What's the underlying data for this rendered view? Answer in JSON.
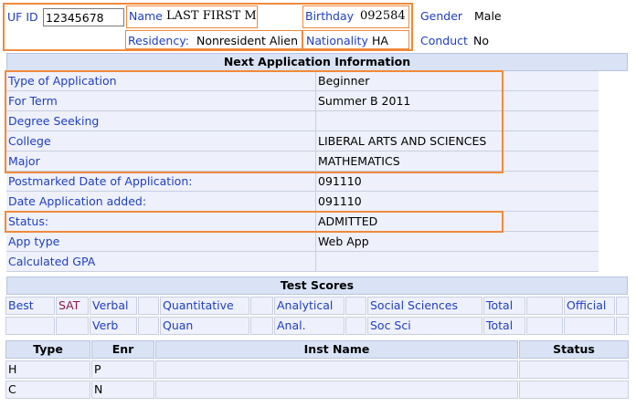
{
  "header": {
    "ufid_label": "UF ID",
    "ufid_value": "12345678",
    "name_label": "Name",
    "name_value": "LAST  FIRST M",
    "birthday_label": "Birthday",
    "birthday_value": "092584",
    "gender_label": "Gender",
    "gender_value": "Male",
    "residency_label": "Residency:",
    "residency_value": "Nonresident Alien",
    "nationality_label": "Nationality",
    "nationality_value": "HA",
    "conduct_label": "Conduct",
    "conduct_value": "No"
  },
  "application": {
    "title": "Next Application Information",
    "rows": [
      {
        "label": "Type of Application",
        "value": "Beginner"
      },
      {
        "label": "For Term",
        "value": "Summer B 2011"
      },
      {
        "label": "Degree Seeking",
        "value": ""
      },
      {
        "label": "College",
        "value": "LIBERAL ARTS AND SCIENCES"
      },
      {
        "label": "Major",
        "value": "MATHEMATICS"
      },
      {
        "label": "Postmarked Date of Application:",
        "value": "091110"
      },
      {
        "label": "Date Application added:",
        "value": "091110"
      },
      {
        "label": "Status:",
        "value": "ADMITTED"
      },
      {
        "label": "App type",
        "value": "Web App"
      },
      {
        "label": "Calculated GPA",
        "value": ""
      }
    ]
  },
  "test_scores": {
    "title": "Test Scores",
    "row1": [
      "Best",
      "SAT",
      "Verbal",
      "",
      "Quantitative",
      "",
      "Analytical",
      "",
      "Social Sciences",
      "Total",
      "",
      "Official",
      ""
    ],
    "row2": [
      "",
      "",
      "Verb",
      "",
      "Quan",
      "",
      "Anal.",
      "",
      "Soc Sci",
      "Total",
      "",
      "",
      ""
    ]
  },
  "inst_table": {
    "headers": [
      "Type",
      "Enr",
      "Inst Name",
      "Status"
    ],
    "rows": [
      [
        "H",
        "P",
        "",
        ""
      ],
      [
        "C",
        "N",
        "",
        ""
      ]
    ]
  },
  "colors": {
    "label": "#1f3fbf",
    "highlight": "#f08a3c",
    "sat": "#8a1a4a"
  }
}
